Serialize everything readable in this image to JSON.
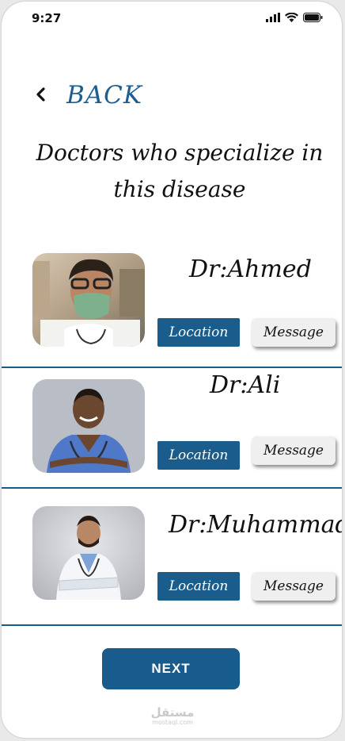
{
  "status_bar": {
    "time": "9:27"
  },
  "header": {
    "back_label": "BACK",
    "title": "Doctors who specialize in this disease"
  },
  "doctors": [
    {
      "name": "Dr:Ahmed",
      "location_label": "Location",
      "message_label": "Message",
      "photo": "doctor-with-face-mask"
    },
    {
      "name": "Dr:Ali",
      "location_label": "Location",
      "message_label": "Message",
      "photo": "doctor-in-blue-scrubs"
    },
    {
      "name": "Dr:Muhammad",
      "location_label": "Location",
      "message_label": "Message",
      "photo": "doctor-in-lab-coat"
    }
  ],
  "footer": {
    "next_label": "NEXT",
    "watermark": "مستقل",
    "watermark_sub": "mostaql.com"
  },
  "colors": {
    "accent": "#1a5d8d",
    "message_bg": "#efefef"
  },
  "icons": [
    "back-chevron-icon",
    "signal-icon",
    "wifi-icon",
    "battery-icon"
  ]
}
